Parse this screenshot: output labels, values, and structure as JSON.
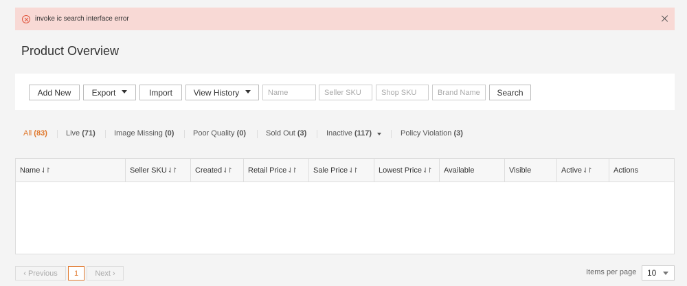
{
  "alert": {
    "message": "invoke ic search interface error",
    "icon": "error-circle-icon"
  },
  "page_title": "Product Overview",
  "toolbar": {
    "add_new": "Add New",
    "export": "Export",
    "import": "Import",
    "view_history": "View History",
    "search": "Search",
    "placeholders": {
      "name": "Name",
      "seller_sku": "Seller SKU",
      "shop_sku": "Shop SKU",
      "brand_name": "Brand Name"
    }
  },
  "tabs": [
    {
      "label": "All",
      "count": "(83)",
      "active": true
    },
    {
      "label": "Live",
      "count": "(71)"
    },
    {
      "label": "Image Missing",
      "count": "(0)"
    },
    {
      "label": "Poor Quality",
      "count": "(0)"
    },
    {
      "label": "Sold Out",
      "count": "(3)"
    },
    {
      "label": "Inactive",
      "count": "(117)",
      "dropdown": true
    },
    {
      "label": "Policy Violation",
      "count": "(3)"
    }
  ],
  "table": {
    "columns": [
      {
        "label": "Name",
        "sortable": true
      },
      {
        "label": "Seller SKU",
        "sortable": true
      },
      {
        "label": "Created",
        "sortable": true
      },
      {
        "label": "Retail Price",
        "sortable": true
      },
      {
        "label": "Sale Price",
        "sortable": true
      },
      {
        "label": "Lowest Price",
        "sortable": true
      },
      {
        "label": "Available",
        "sortable": false
      },
      {
        "label": "Visible",
        "sortable": false
      },
      {
        "label": "Active",
        "sortable": true
      },
      {
        "label": "Actions",
        "sortable": false
      }
    ],
    "sort_glyph": "⇃↾",
    "rows": []
  },
  "pagination": {
    "previous": "Previous",
    "current_page": "1",
    "next": "Next",
    "items_per_page_label": "Items per page",
    "items_per_page": "10"
  },
  "colors": {
    "accent": "#e0782c",
    "alert_bg": "#f8d9d5",
    "error": "#e0533a"
  }
}
